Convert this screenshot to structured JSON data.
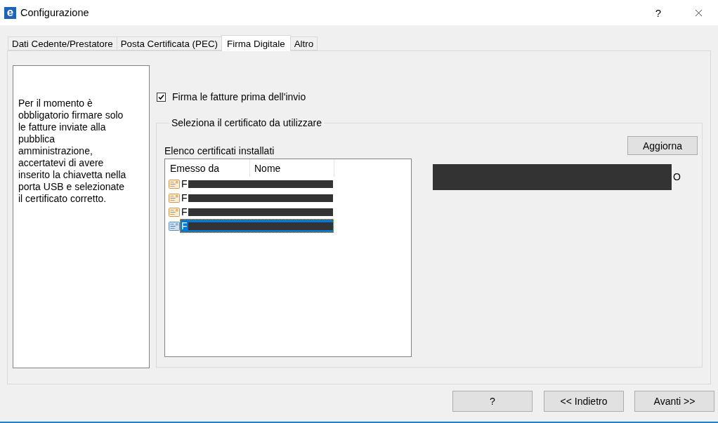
{
  "window": {
    "app_icon_letter": "e",
    "title": "Configurazione",
    "help": "?"
  },
  "tabs": [
    {
      "label": "Dati Cedente/Prestatore",
      "selected": false
    },
    {
      "label": "Posta Certificata (PEC)",
      "selected": false
    },
    {
      "label": "Firma Digitale",
      "selected": true
    },
    {
      "label": "Altro",
      "selected": false
    }
  ],
  "info_panel": {
    "text": "Per il momento è obbligatorio firmare solo le fatture inviate alla pubblica amministrazione, accertatevi di avere inserito la chiavetta nella porta USB e selezionate il certificato corretto."
  },
  "sign_option": {
    "label": "Firma le fatture prima dell'invio",
    "checked": true
  },
  "certificate_group": {
    "title": "Seleziona il certificato da utilizzare",
    "list_label": "Elenco certificati installati",
    "columns": [
      "Emesso da",
      "Nome"
    ],
    "rows": [
      {
        "issuer": "F",
        "selected": false
      },
      {
        "issuer": "F",
        "selected": false
      },
      {
        "issuer": "F",
        "selected": false
      },
      {
        "issuer": "F",
        "selected": true
      }
    ],
    "refresh_button": "Aggiorna",
    "details": "O"
  },
  "buttons": [
    {
      "label": "?"
    },
    {
      "label": "<< Indietro"
    },
    {
      "label": "Avanti >>"
    }
  ]
}
